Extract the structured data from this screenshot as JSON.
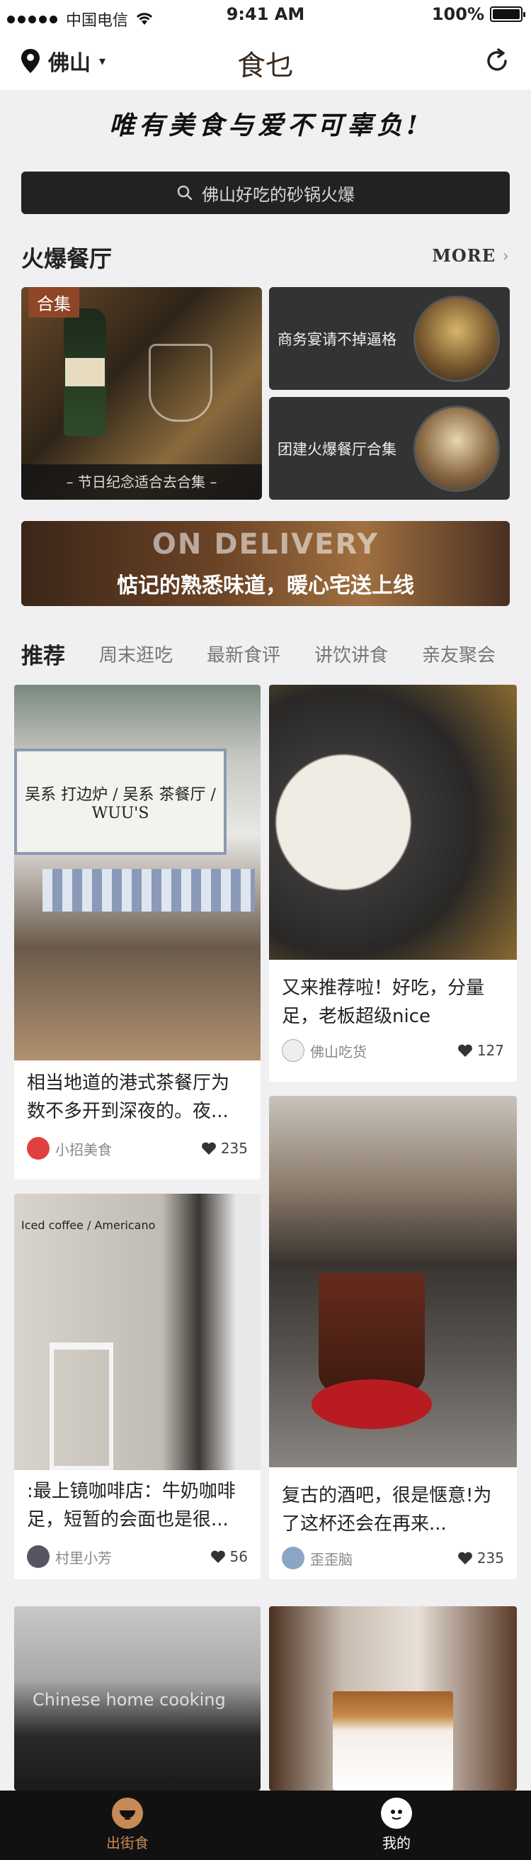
{
  "status_bar": {
    "carrier": "中国电信",
    "time": "9:41 AM",
    "battery": "100%"
  },
  "nav": {
    "city": "佛山",
    "logo": "食乜"
  },
  "slogan": "唯有美食与爱不可辜负!",
  "search": {
    "placeholder": "佛山好吃的砂锅火爆"
  },
  "section": {
    "title": "火爆餐厅",
    "more": "MORE"
  },
  "featured": {
    "big": {
      "tag": "合集",
      "caption": "– 节日纪念适合去合集 –"
    },
    "small": [
      {
        "title": "商务宴请不掉逼格"
      },
      {
        "title": "团建火爆餐厅合集"
      }
    ]
  },
  "banner": {
    "headline": "ON DELIVERY",
    "subtitle": "惦记的熟悉味道，暖心宅送上线"
  },
  "tabs": [
    {
      "label": "推荐",
      "active": true
    },
    {
      "label": "周末逛吃"
    },
    {
      "label": "最新食评"
    },
    {
      "label": "讲饮讲食"
    },
    {
      "label": "亲友聚会"
    }
  ],
  "posts": [
    {
      "title": "相当地道的港式茶餐厅为数不多开到深夜的。夜...",
      "author": "小招美食",
      "likes": "235",
      "image_text": "吴系 打边炉 / 吴系 茶餐厅 / WUU'S"
    },
    {
      "title": "又来推荐啦！好吃，分量足，老板超级nice",
      "author": "佛山吃货",
      "likes": "127"
    },
    {
      "title": ":最上镜咖啡店：牛奶咖啡足，短暂的会面也是很...",
      "author": "村里小芳",
      "likes": "56",
      "image_text": "Iced coffee / Americano"
    },
    {
      "title": "复古的酒吧，很是惬意!为了这杯还会在再来...",
      "author": "歪歪脑",
      "likes": "235"
    },
    {
      "title": "",
      "author": "",
      "likes": "",
      "image_text": "Chinese home cooking"
    }
  ],
  "bottom_nav": [
    {
      "label": "出街食",
      "active": true,
      "color": "#c58a55"
    },
    {
      "label": "我的",
      "active": false,
      "color": "#ffffff"
    }
  ]
}
